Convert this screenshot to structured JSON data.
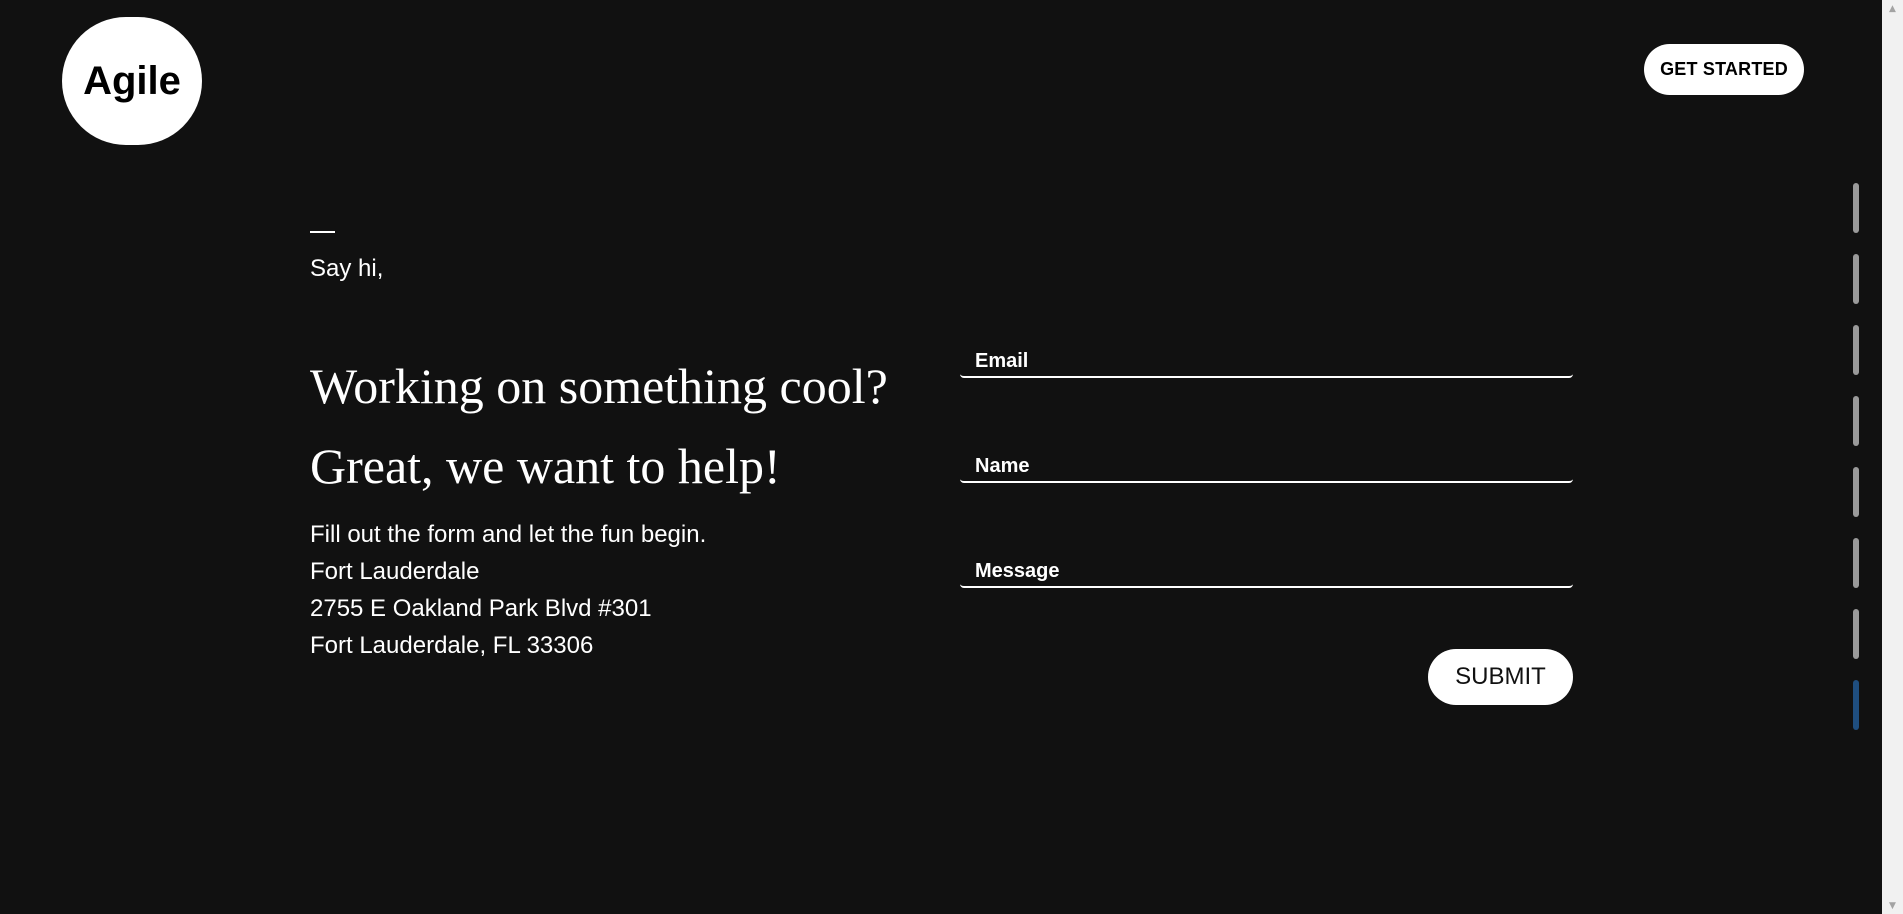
{
  "header": {
    "logo_text": "Agile",
    "cta_label": "GET STARTED"
  },
  "intro": {
    "eyebrow": "Say hi,",
    "headline_line1": "Working on something cool?",
    "headline_line2": "Great, we want to help!",
    "body_lines": [
      "Fill out the form and let the fun begin.",
      "Fort Lauderdale",
      "2755 E Oakland Park Blvd #301",
      "Fort Lauderdale, FL 33306"
    ]
  },
  "form": {
    "fields": [
      {
        "label": "Email"
      },
      {
        "label": "Name"
      },
      {
        "label": "Message"
      }
    ],
    "submit_label": "SUBMIT"
  },
  "section_nav": {
    "count": 8,
    "active_index": 7,
    "active_color": "#1f4e7f",
    "inactive_color": "#9a9a9a"
  },
  "scrollbar": {
    "up_icon": "▲",
    "down_icon": "▼"
  }
}
